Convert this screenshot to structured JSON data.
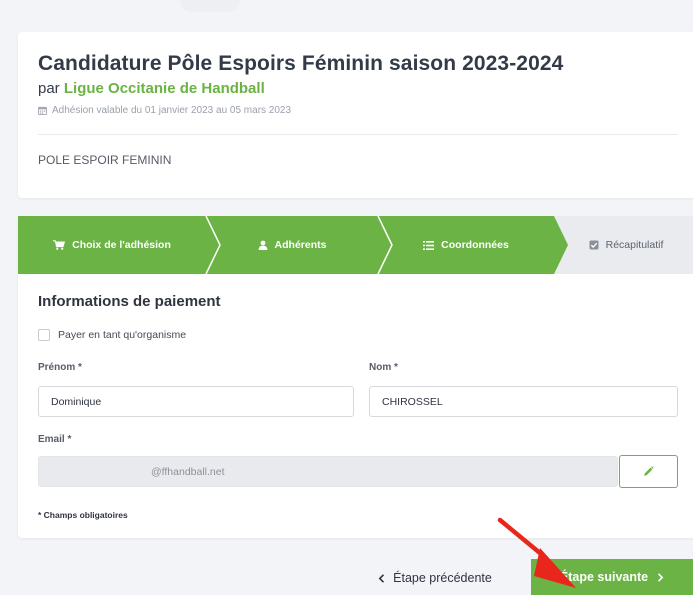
{
  "header": {
    "title": "Candidature Pôle Espoirs Féminin saison 2023-2024",
    "by_prefix": "par",
    "organization": "Ligue Occitanie de Handball",
    "validity": "Adhésion valable du 01 janvier 2023 au 05 mars 2023",
    "category": "POLE ESPOIR FEMININ"
  },
  "steps": [
    {
      "label": "Choix de l'adhésion",
      "icon": "cart-icon",
      "state": "done"
    },
    {
      "label": "Adhérents",
      "icon": "user-icon",
      "state": "done"
    },
    {
      "label": "Coordonnées",
      "icon": "list-icon",
      "state": "done"
    },
    {
      "label": "Récapitulatif",
      "icon": "checkbox-icon",
      "state": "current"
    }
  ],
  "form": {
    "section_title": "Informations de paiement",
    "organization_checkbox_label": "Payer en tant qu'organisme",
    "prenom_label": "Prénom *",
    "prenom_value": "Dominique",
    "nom_label": "Nom *",
    "nom_value": "CHIROSSEL",
    "email_label": "Email *",
    "email_value": "@ffhandball.net",
    "required_note": "* Champs obligatoires"
  },
  "footer": {
    "prev_label": "Étape précédente",
    "next_label": "Étape suivante"
  },
  "colors": {
    "accent": "#6ab344",
    "step_inactive": "#e9ebef",
    "arrow": "#e8261c"
  }
}
